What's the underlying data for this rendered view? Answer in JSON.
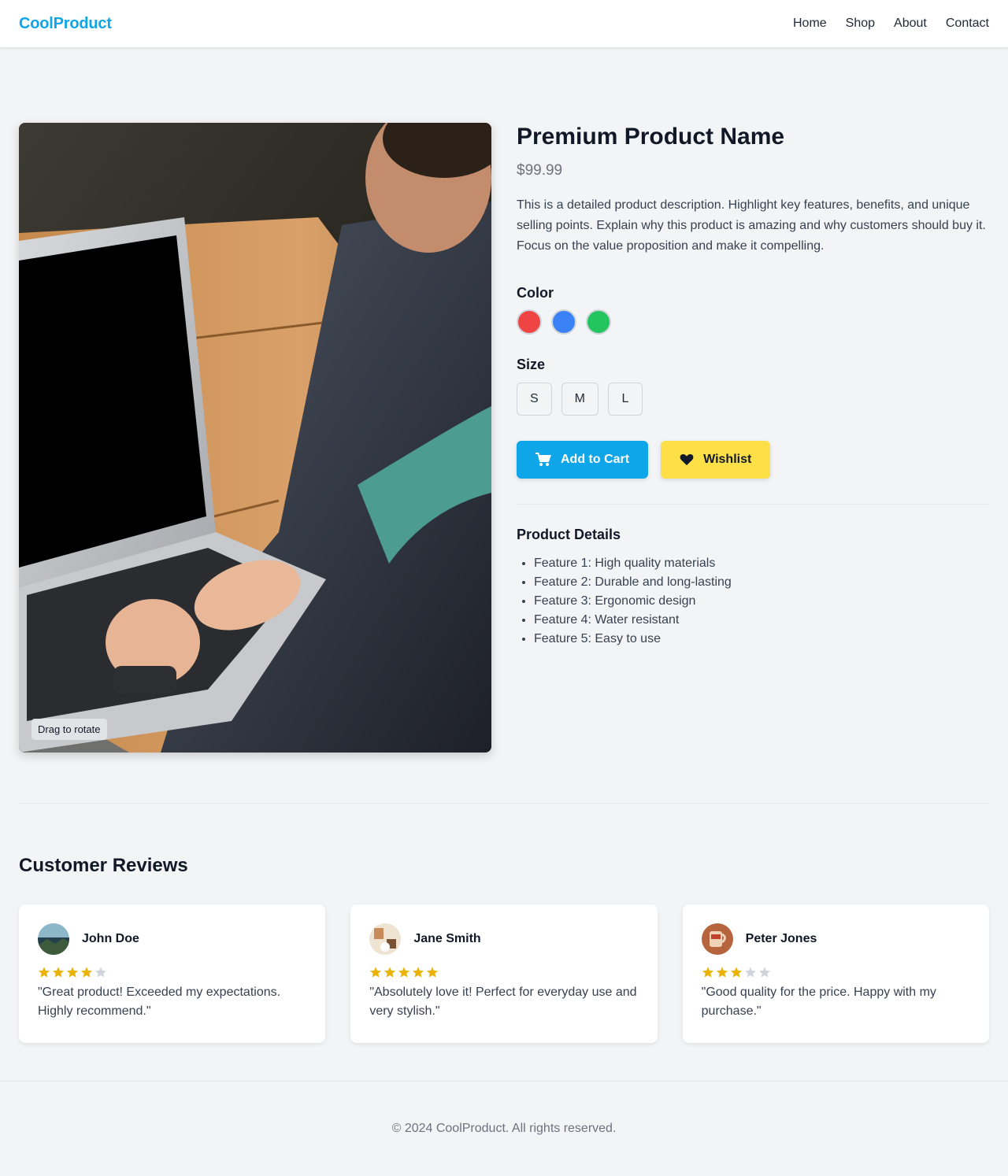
{
  "header": {
    "logo": "CoolProduct",
    "nav": [
      "Home",
      "Shop",
      "About",
      "Contact"
    ]
  },
  "product": {
    "title": "Premium Product Name",
    "price": "$99.99",
    "description": "This is a detailed product description. Highlight key features, benefits, and unique selling points. Explain why this product is amazing and why customers should buy it. Focus on the value proposition and make it compelling.",
    "image_hint": "Drag to rotate",
    "image_subject": "person typing on a laptop at a wooden table",
    "color_label": "Color",
    "colors": [
      "#ef4444",
      "#3b82f6",
      "#22c55e"
    ],
    "size_label": "Size",
    "sizes": [
      "S",
      "M",
      "L"
    ],
    "add_to_cart": "Add to Cart",
    "wishlist": "Wishlist",
    "details_title": "Product Details",
    "features": [
      "Feature 1: High quality materials",
      "Feature 2: Durable and long-lasting",
      "Feature 3: Ergonomic design",
      "Feature 4: Water resistant",
      "Feature 5: Easy to use"
    ]
  },
  "reviews": {
    "title": "Customer Reviews",
    "items": [
      {
        "name": "John Doe",
        "rating": 4,
        "text": "\"Great product! Exceeded my expectations. Highly recommend.\""
      },
      {
        "name": "Jane Smith",
        "rating": 5,
        "text": "\"Absolutely love it! Perfect for everyday use and very stylish.\""
      },
      {
        "name": "Peter Jones",
        "rating": 3,
        "text": "\"Good quality for the price. Happy with my purchase.\""
      }
    ]
  },
  "footer": {
    "copyright": "© 2024 CoolProduct. All rights reserved."
  },
  "colors": {
    "brand": "#0ea5e9",
    "wishlist": "#fde047",
    "star_filled": "#eab308",
    "star_empty": "#d1d5db"
  }
}
